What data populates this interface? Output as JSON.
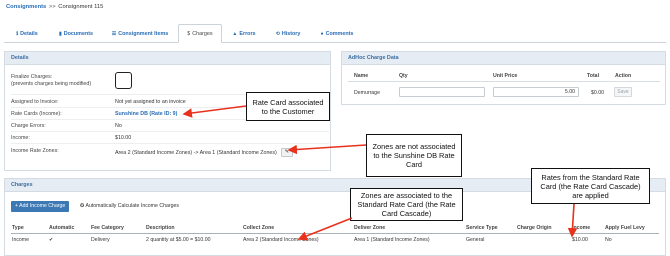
{
  "breadcrumb": {
    "link": "Consignments",
    "separator": ">>",
    "current": "Consignment 115"
  },
  "tabs": [
    {
      "label": "Details",
      "icon": "info-icon"
    },
    {
      "label": "Documents",
      "icon": "document-icon"
    },
    {
      "label": "Consignment Items",
      "icon": "list-icon"
    },
    {
      "label": "Charges",
      "icon": "dollar-icon"
    },
    {
      "label": "Errors",
      "icon": "warning-icon"
    },
    {
      "label": "History",
      "icon": "history-icon"
    },
    {
      "label": "Comments",
      "icon": "comment-icon"
    }
  ],
  "details": {
    "title": "Details",
    "finalize_label": "Finalize Charges:",
    "finalize_sub": "(prevents charges being modified)",
    "assigned_label": "Assigned to Invoice:",
    "assigned_value": "Not yet assigned to an invoice",
    "rate_card_label": "Rate Cards (Income):",
    "rate_card_value": "Sunshine DB (Rate ID: 9)",
    "errors_label": "Charge Errors:",
    "errors_value": "No",
    "income_label": "Income:",
    "income_value": "$10.00",
    "zones_label": "Income Rate Zones:",
    "zones_value": "Area 2 (Standard Income Zones) -> Area 1 (Standard Income Zones)"
  },
  "adhoc": {
    "title": "AdHoc Charge Data",
    "columns": [
      "Name",
      "Qty",
      "Unit Price",
      "Total",
      "Action"
    ],
    "row": {
      "name": "Demurrage",
      "qty": "",
      "unit_price": "5.00",
      "total": "$0.00",
      "action": "Save"
    }
  },
  "charges": {
    "title": "Charges",
    "add_button": "+ Add Income Charge",
    "auto_button": "Automatically Calculate Income Charges",
    "columns": [
      "Type",
      "Automatic",
      "Fee Category",
      "Description",
      "Collect Zone",
      "Deliver Zone",
      "Service Type",
      "Charge Origin",
      "Income",
      "Apply Fuel Levy"
    ],
    "rows": [
      {
        "type": "Income",
        "automatic": "✔",
        "fee_category": "Delivery",
        "description": "2 quantity at $5.00 = $10.00",
        "collect_zone": "Area 2 (Standard Income Zones)",
        "deliver_zone": "Area 1 (Standard Income Zones)",
        "service_type": "General",
        "charge_origin": "",
        "income": "$10.00",
        "fuel_levy": "No"
      }
    ]
  },
  "annotations": {
    "rate_card": "Rate Card associated to the Customer",
    "zones_not": "Zones are not associated to the Sunshine DB Rate Card",
    "zones_are": "Zones are associated to the Standard Rate Card (the Rate Card Cascade)",
    "rates_from": "Rates from the Standard Rate Card (the Rate Card Cascade) are applied",
    "color": "#e8321e"
  }
}
